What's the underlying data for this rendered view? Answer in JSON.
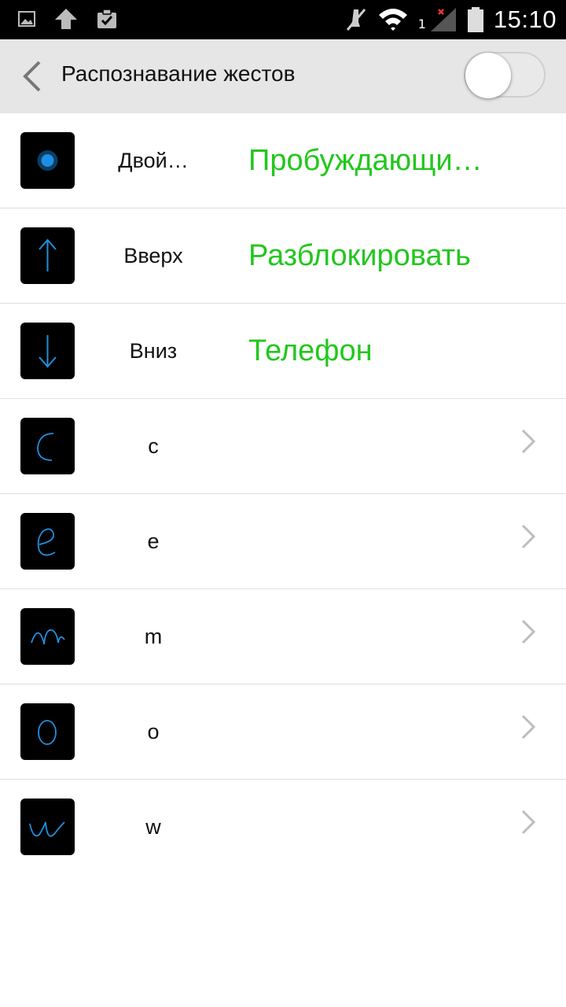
{
  "status_bar": {
    "time": "15:10",
    "sim_slot": "1",
    "icons": [
      "gallery-icon",
      "upload-icon",
      "clipboard-check-icon",
      "mute-icon",
      "wifi-icon",
      "signal-icon",
      "battery-icon"
    ]
  },
  "app_bar": {
    "title": "Распознавание жестов",
    "toggle_on": false
  },
  "gestures": [
    {
      "name": "Двой…",
      "action": "Пробуждающи…",
      "thumb": "double-tap-icon"
    },
    {
      "name": "Вверх",
      "action": "Разблокировать",
      "thumb": "arrow-up-icon"
    },
    {
      "name": "Вниз",
      "action": "Телефон",
      "thumb": "arrow-down-icon"
    },
    {
      "name": "c",
      "action": "",
      "thumb": "letter-c-gesture-icon"
    },
    {
      "name": "e",
      "action": "",
      "thumb": "letter-e-gesture-icon"
    },
    {
      "name": "m",
      "action": "",
      "thumb": "letter-m-gesture-icon"
    },
    {
      "name": "o",
      "action": "",
      "thumb": "letter-o-gesture-icon"
    },
    {
      "name": "w",
      "action": "",
      "thumb": "letter-w-gesture-icon"
    }
  ],
  "colors": {
    "action_green": "#22c71d",
    "gesture_blue": "#1e8fe0"
  }
}
